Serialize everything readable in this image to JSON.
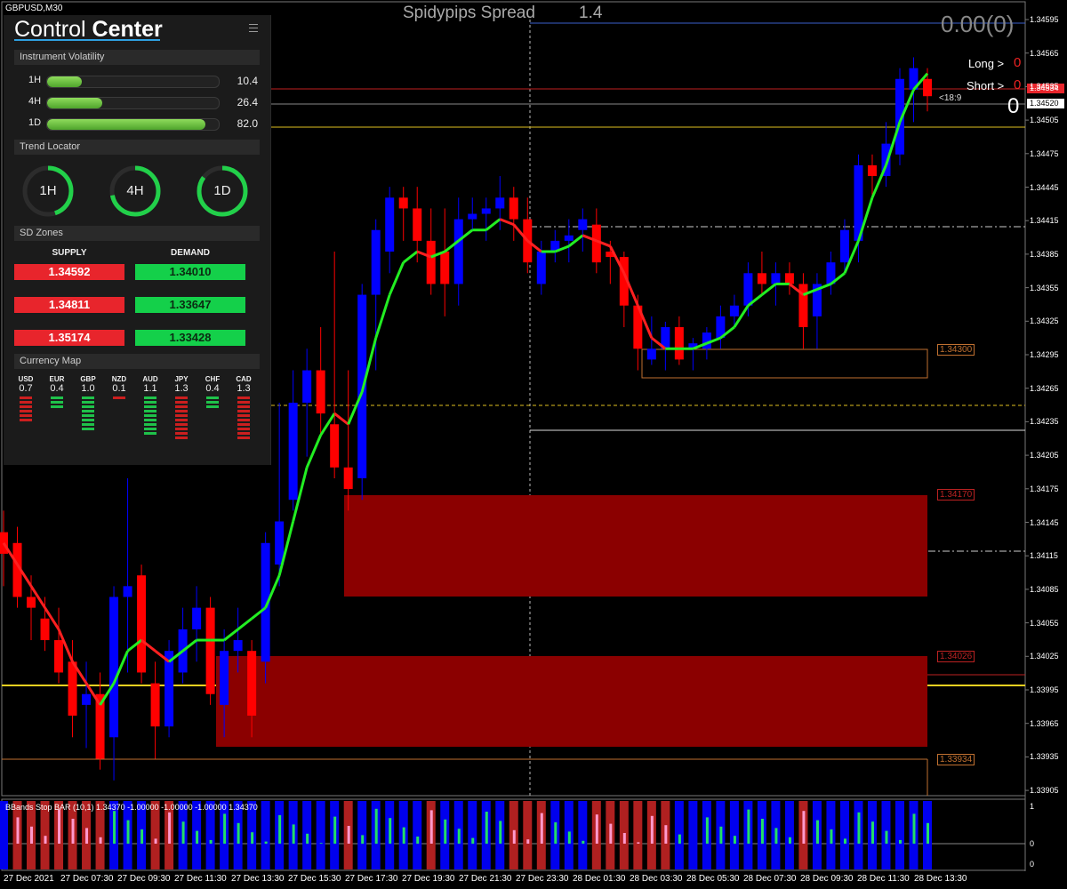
{
  "header": {
    "symbol": "GBPUSD,M30",
    "spread_label": "Spidypips Spread",
    "spread_value": "1.4",
    "pl": "0.00(0)"
  },
  "trade": {
    "long_label": "Long >",
    "long_value": "0",
    "short_label": "Short >",
    "short_value": "0",
    "big_value": "0",
    "timer": "<18:9"
  },
  "control_center": {
    "title_light": "Control ",
    "title_bold": "Center",
    "volatility": {
      "header": "Instrument Volatility",
      "rows": [
        {
          "label": "1H",
          "value": "10.4",
          "fraction": 0.2
        },
        {
          "label": "4H",
          "value": "26.4",
          "fraction": 0.32
        },
        {
          "label": "1D",
          "value": "82.0",
          "fraction": 0.92
        }
      ]
    },
    "trend": {
      "header": "Trend Locator",
      "items": [
        {
          "label": "1H",
          "fraction": 0.45
        },
        {
          "label": "4H",
          "fraction": 0.72
        },
        {
          "label": "1D",
          "fraction": 0.85
        }
      ]
    },
    "zones": {
      "header": "SD Zones",
      "supply_label": "SUPPLY",
      "demand_label": "DEMAND",
      "rows": [
        {
          "supply": "1.34592",
          "demand": "1.34010"
        },
        {
          "supply": "1.34811",
          "demand": "1.33647"
        },
        {
          "supply": "1.35174",
          "demand": "1.33428"
        }
      ]
    },
    "currency_map": {
      "header": "Currency Map",
      "items": [
        {
          "name": "USD",
          "value": "0.7",
          "color": "#cc1f1f",
          "bars": 6
        },
        {
          "name": "EUR",
          "value": "0.4",
          "color": "#1fc24a",
          "bars": 3
        },
        {
          "name": "GBP",
          "value": "1.0",
          "color": "#1fc24a",
          "bars": 8
        },
        {
          "name": "NZD",
          "value": "0.1",
          "color": "#cc1f1f",
          "bars": 1
        },
        {
          "name": "AUD",
          "value": "1.1",
          "color": "#1fc24a",
          "bars": 9
        },
        {
          "name": "JPY",
          "value": "1.3",
          "color": "#cc1f1f",
          "bars": 10
        },
        {
          "name": "CHF",
          "value": "0.4",
          "color": "#1fc24a",
          "bars": 3
        },
        {
          "name": "CAD",
          "value": "1.3",
          "color": "#cc1f1f",
          "bars": 10
        }
      ]
    }
  },
  "price_axis": [
    "1.34595",
    "1.34565",
    "1.34535",
    "1.34505",
    "1.34475",
    "1.34445",
    "1.34415",
    "1.34385",
    "1.34355",
    "1.34325",
    "1.34295",
    "1.34265",
    "1.34235",
    "1.34205",
    "1.34175",
    "1.34145",
    "1.34115",
    "1.34085",
    "1.34055",
    "1.34025",
    "1.33995",
    "1.33965",
    "1.33935",
    "1.33905"
  ],
  "price_tags": {
    "ask": "1.34534",
    "bid": "1.34520"
  },
  "zone_labels": [
    "1.34300",
    "1.34170",
    "1.34026",
    "1.33934"
  ],
  "time_axis": [
    "27 Dec 2021",
    "27 Dec 07:30",
    "27 Dec 09:30",
    "27 Dec 11:30",
    "27 Dec 13:30",
    "27 Dec 15:30",
    "27 Dec 17:30",
    "27 Dec 19:30",
    "27 Dec 21:30",
    "27 Dec 23:30",
    "28 Dec 01:30",
    "28 Dec 03:30",
    "28 Dec 05:30",
    "28 Dec 07:30",
    "28 Dec 09:30",
    "28 Dec 11:30",
    "28 Dec 13:30"
  ],
  "indicator": {
    "label": "BBands Stop BAR (10,1) 1.34370 -1.00000 -1.00000 -1.00000 1.34370",
    "axis_top": "1",
    "axis_mid": "0",
    "axis_bottom": "0"
  },
  "chart_data": {
    "type": "candlestick",
    "ylim": [
      1.3389,
      1.34605
    ],
    "candles": [
      [
        1.3413,
        1.3415,
        1.3408,
        1.3411
      ],
      [
        1.3412,
        1.34135,
        1.3406,
        1.3407
      ],
      [
        1.3407,
        1.3409,
        1.3403,
        1.3406
      ],
      [
        1.3405,
        1.3407,
        1.3402,
        1.3403
      ],
      [
        1.3403,
        1.3406,
        1.3399,
        1.34
      ],
      [
        1.3401,
        1.3403,
        1.3394,
        1.3396
      ],
      [
        1.3397,
        1.3401,
        1.3393,
        1.3398
      ],
      [
        1.3398,
        1.34,
        1.3391,
        1.3392
      ],
      [
        1.3394,
        1.3408,
        1.339,
        1.3407
      ],
      [
        1.3407,
        1.3418,
        1.34,
        1.3408
      ],
      [
        1.3409,
        1.341,
        1.3399,
        1.34
      ],
      [
        1.3399,
        1.3401,
        1.3392,
        1.3395
      ],
      [
        1.3395,
        1.3403,
        1.3394,
        1.3402
      ],
      [
        1.34,
        1.3406,
        1.3399,
        1.3404
      ],
      [
        1.3404,
        1.3408,
        1.3401,
        1.3406
      ],
      [
        1.3406,
        1.3407,
        1.3397,
        1.3398
      ],
      [
        1.3397,
        1.3404,
        1.3394,
        1.3402
      ],
      [
        1.3402,
        1.3406,
        1.34,
        1.3403
      ],
      [
        1.3402,
        1.3403,
        1.3394,
        1.3396
      ],
      [
        1.3401,
        1.3413,
        1.3399,
        1.3412
      ],
      [
        1.341,
        1.3425,
        1.3408,
        1.3414
      ],
      [
        1.3416,
        1.3428,
        1.3415,
        1.3425
      ],
      [
        1.3425,
        1.343,
        1.342,
        1.3428
      ],
      [
        1.3428,
        1.3432,
        1.3422,
        1.3424
      ],
      [
        1.3423,
        1.3439,
        1.3418,
        1.3419
      ],
      [
        1.3419,
        1.3428,
        1.3415,
        1.3417
      ],
      [
        1.3418,
        1.3436,
        1.3416,
        1.3435
      ],
      [
        1.3435,
        1.3442,
        1.3428,
        1.3441
      ],
      [
        1.3439,
        1.3445,
        1.3437,
        1.3444
      ],
      [
        1.3444,
        1.3445,
        1.344,
        1.3443
      ],
      [
        1.3443,
        1.3445,
        1.3438,
        1.344
      ],
      [
        1.344,
        1.3443,
        1.3435,
        1.3436
      ],
      [
        1.3439,
        1.3443,
        1.3433,
        1.3436
      ],
      [
        1.3436,
        1.3444,
        1.3434,
        1.3442
      ],
      [
        1.3442,
        1.3444,
        1.3441,
        1.34425
      ],
      [
        1.34425,
        1.3444,
        1.344,
        1.3443
      ],
      [
        1.3443,
        1.3446,
        1.3441,
        1.3444
      ],
      [
        1.3444,
        1.3445,
        1.344,
        1.3442
      ],
      [
        1.3442,
        1.3444,
        1.3437,
        1.3438
      ],
      [
        1.3436,
        1.344,
        1.3435,
        1.3439
      ],
      [
        1.3439,
        1.3441,
        1.3438,
        1.344
      ],
      [
        1.344,
        1.3442,
        1.3438,
        1.34405
      ],
      [
        1.3441,
        1.3443,
        1.3439,
        1.3442
      ],
      [
        1.34415,
        1.3443,
        1.3437,
        1.3438
      ],
      [
        1.3439,
        1.344,
        1.3436,
        1.34385
      ],
      [
        1.34385,
        1.3439,
        1.3432,
        1.3434
      ],
      [
        1.3434,
        1.3435,
        1.3428,
        1.343
      ],
      [
        1.3429,
        1.3433,
        1.34285,
        1.343
      ],
      [
        1.343,
        1.34325,
        1.3428,
        1.3432
      ],
      [
        1.3432,
        1.3433,
        1.34285,
        1.3429
      ],
      [
        1.343,
        1.3431,
        1.3428,
        1.34305
      ],
      [
        1.343,
        1.3432,
        1.3429,
        1.34315
      ],
      [
        1.3431,
        1.3434,
        1.343,
        1.3433
      ],
      [
        1.3433,
        1.3435,
        1.3432,
        1.3434
      ],
      [
        1.3434,
        1.3438,
        1.3433,
        1.3437
      ],
      [
        1.3437,
        1.3439,
        1.3435,
        1.3436
      ],
      [
        1.3436,
        1.3438,
        1.3434,
        1.3437
      ],
      [
        1.3437,
        1.3438,
        1.3435,
        1.3436
      ],
      [
        1.3436,
        1.3437,
        1.343,
        1.3432
      ],
      [
        1.3433,
        1.3437,
        1.343,
        1.3436
      ],
      [
        1.3436,
        1.3439,
        1.3435,
        1.3438
      ],
      [
        1.3438,
        1.3442,
        1.3437,
        1.3441
      ],
      [
        1.344,
        1.3448,
        1.3438,
        1.3447
      ],
      [
        1.3447,
        1.3448,
        1.3444,
        1.3446
      ],
      [
        1.3446,
        1.3451,
        1.3445,
        1.3449
      ],
      [
        1.3448,
        1.3456,
        1.3447,
        1.3455
      ],
      [
        1.3454,
        1.3457,
        1.3451,
        1.3456
      ],
      [
        1.3455,
        1.3456,
        1.3452,
        1.34534
      ]
    ],
    "ma": [
      1.3412,
      1.341,
      1.3408,
      1.3406,
      1.3404,
      1.3401,
      1.3399,
      1.3397,
      1.3399,
      1.3402,
      1.3403,
      1.3402,
      1.3401,
      1.3402,
      1.3403,
      1.3403,
      1.3403,
      1.3404,
      1.3405,
      1.3406,
      1.3409,
      1.3414,
      1.3419,
      1.3422,
      1.3424,
      1.3423,
      1.3426,
      1.3431,
      1.3435,
      1.3438,
      1.3439,
      1.34385,
      1.3439,
      1.344,
      1.3441,
      1.3441,
      1.3442,
      1.34415,
      1.344,
      1.3439,
      1.3439,
      1.34395,
      1.34405,
      1.344,
      1.34395,
      1.3437,
      1.3434,
      1.3431,
      1.343,
      1.343,
      1.343,
      1.34305,
      1.3431,
      1.3432,
      1.3434,
      1.3435,
      1.3436,
      1.3436,
      1.3435,
      1.34355,
      1.3436,
      1.3437,
      1.344,
      1.3444,
      1.3447,
      1.3451,
      1.3454,
      1.34555
    ]
  }
}
